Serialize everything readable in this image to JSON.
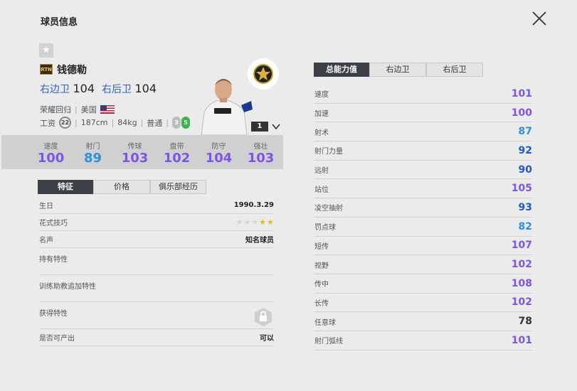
{
  "header": {
    "title": "球员信息"
  },
  "player": {
    "season_badge": "RTN",
    "name": "钱德勒",
    "positions": [
      {
        "label": "右边卫",
        "value": "104"
      },
      {
        "label": "右后卫",
        "value": "104"
      }
    ],
    "team": "荣耀回归",
    "nation": "美国",
    "salary_label": "工资",
    "salary": "22",
    "height": "187cm",
    "weight": "84kg",
    "body": "普通",
    "weak_foot": "3",
    "strong_foot": "5",
    "level": "1"
  },
  "summary_stats": [
    {
      "label": "速度",
      "value": "100",
      "color": "#7d55e6"
    },
    {
      "label": "射门",
      "value": "89",
      "color": "#2f8fd8"
    },
    {
      "label": "传球",
      "value": "103",
      "color": "#7d55e6"
    },
    {
      "label": "盘带",
      "value": "102",
      "color": "#7d55e6"
    },
    {
      "label": "防守",
      "value": "104",
      "color": "#7d55e6"
    },
    {
      "label": "强壮",
      "value": "103",
      "color": "#7d55e6"
    }
  ],
  "left_tabs": [
    "特征",
    "价格",
    "俱乐部经历"
  ],
  "features": {
    "birth_label": "生日",
    "birth": "1990.3.29",
    "skill_label": "花式技巧",
    "skill_stars": 2,
    "skill_max": 5,
    "fame_label": "名声",
    "fame": "知名球员",
    "traits_label": "持有特性",
    "coach_traits_label": "训练助教追加特性",
    "acquired_traits_label": "获得特性",
    "tradable_label": "是否可产出",
    "tradable": "可以"
  },
  "right_tabs": [
    "总能力值",
    "右边卫",
    "右后卫"
  ],
  "attributes": [
    {
      "label": "速度",
      "value": "101",
      "color": "#7d55e6"
    },
    {
      "label": "加速",
      "value": "100",
      "color": "#7d55e6"
    },
    {
      "label": "射术",
      "value": "87",
      "color": "#2f8fd8"
    },
    {
      "label": "射门力量",
      "value": "92",
      "color": "#2455c8"
    },
    {
      "label": "远射",
      "value": "90",
      "color": "#2455c8"
    },
    {
      "label": "站位",
      "value": "105",
      "color": "#7d55e6"
    },
    {
      "label": "凌空抽射",
      "value": "93",
      "color": "#2455c8"
    },
    {
      "label": "罚点球",
      "value": "82",
      "color": "#2f8fd8"
    },
    {
      "label": "短传",
      "value": "107",
      "color": "#7d55e6"
    },
    {
      "label": "视野",
      "value": "102",
      "color": "#7d55e6"
    },
    {
      "label": "传中",
      "value": "108",
      "color": "#7d55e6"
    },
    {
      "label": "长传",
      "value": "102",
      "color": "#7d55e6"
    },
    {
      "label": "任意球",
      "value": "78",
      "color": "#333333"
    },
    {
      "label": "射门弧线",
      "value": "101",
      "color": "#7d55e6"
    }
  ]
}
